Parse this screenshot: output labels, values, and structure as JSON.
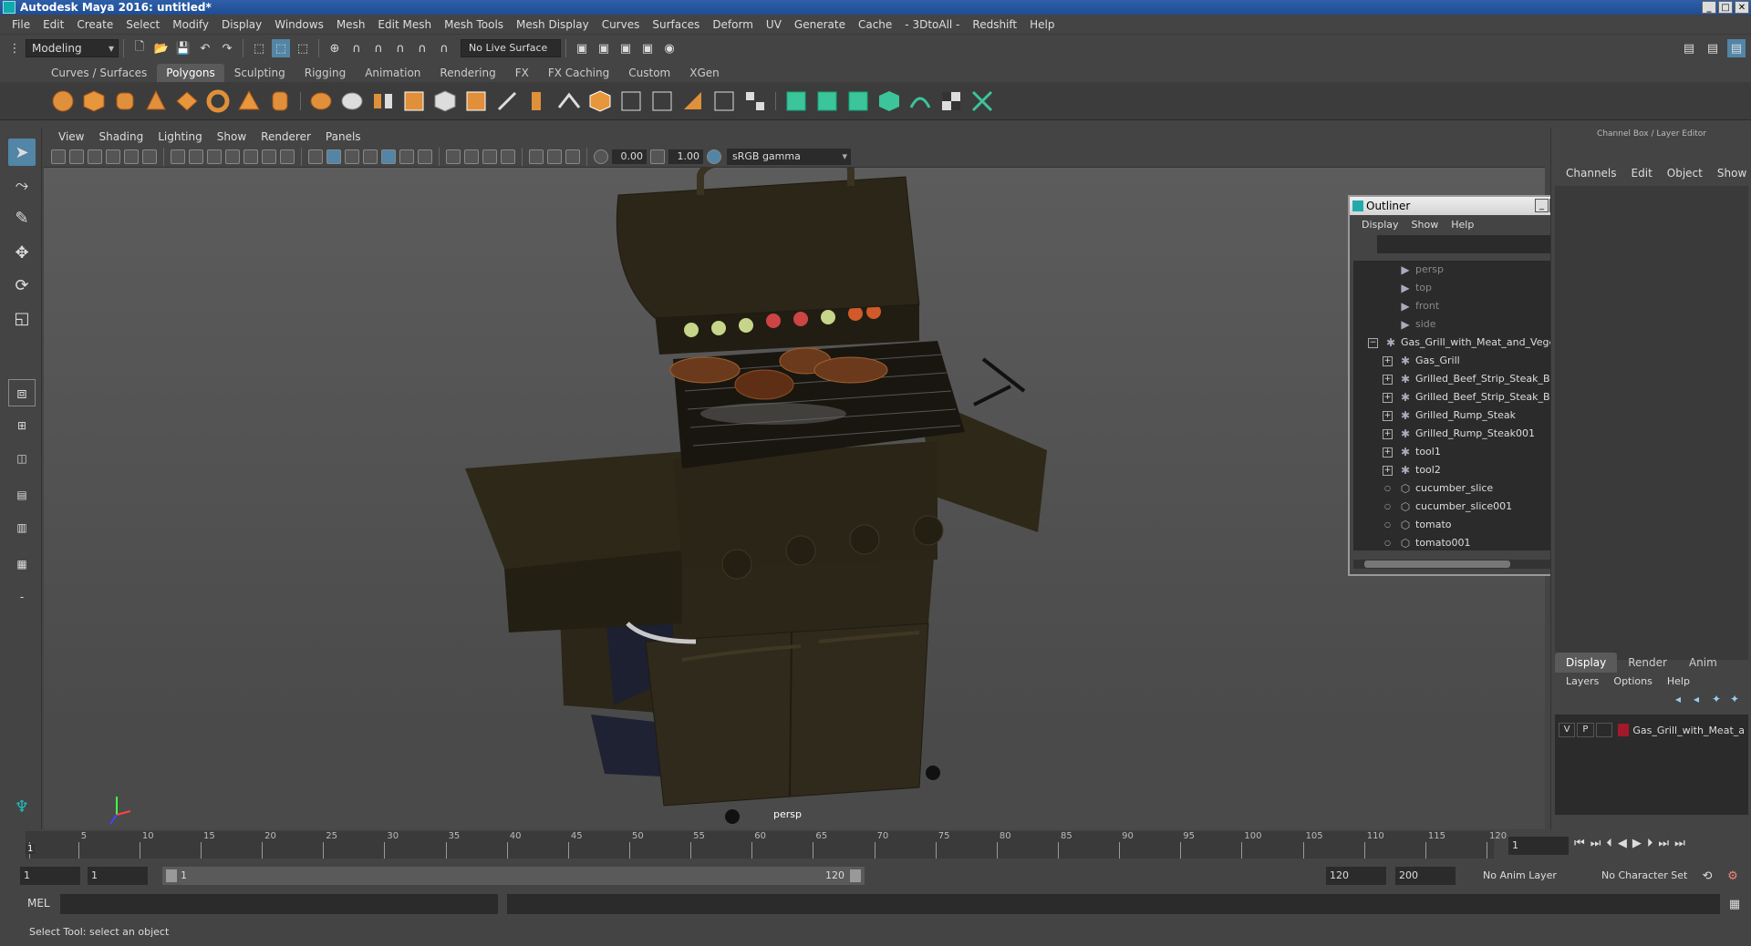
{
  "window": {
    "title": "Autodesk Maya 2016: untitled*",
    "min": "_",
    "max": "□",
    "close": "✕"
  },
  "menubar": [
    "File",
    "Edit",
    "Create",
    "Select",
    "Modify",
    "Display",
    "Windows",
    "Mesh",
    "Edit Mesh",
    "Mesh Tools",
    "Mesh Display",
    "Curves",
    "Surfaces",
    "Deform",
    "UV",
    "Generate",
    "Cache",
    "- 3DtoAll -",
    "Redshift",
    "Help"
  ],
  "statusline": {
    "mode": "Modeling",
    "live_surface": "No Live Surface"
  },
  "shelf": {
    "tabs": [
      "Curves / Surfaces",
      "Polygons",
      "Sculpting",
      "Rigging",
      "Animation",
      "Rendering",
      "FX",
      "FX Caching",
      "Custom",
      "XGen"
    ],
    "active_tab": "Polygons"
  },
  "panel": {
    "menus": [
      "View",
      "Shading",
      "Lighting",
      "Show",
      "Renderer",
      "Panels"
    ],
    "exposure": "0.00",
    "gamma_value": "1.00",
    "color_space": "sRGB gamma",
    "camera_label": "persp"
  },
  "outliner": {
    "title": "Outliner",
    "menus": [
      "Display",
      "Show",
      "Help"
    ],
    "items": [
      {
        "label": "persp",
        "type": "camera",
        "dim": true
      },
      {
        "label": "top",
        "type": "camera",
        "dim": true
      },
      {
        "label": "front",
        "type": "camera",
        "dim": true
      },
      {
        "label": "side",
        "type": "camera",
        "dim": true
      },
      {
        "label": "Gas_Grill_with_Meat_and_Vegeta",
        "type": "group",
        "expander": "−"
      },
      {
        "label": "Gas_Grill",
        "type": "group",
        "expander": "+"
      },
      {
        "label": "Grilled_Beef_Strip_Steak_Bon",
        "type": "group",
        "expander": "+"
      },
      {
        "label": "Grilled_Beef_Strip_Steak_Bon",
        "type": "group",
        "expander": "+"
      },
      {
        "label": "Grilled_Rump_Steak",
        "type": "group",
        "expander": "+"
      },
      {
        "label": "Grilled_Rump_Steak001",
        "type": "group",
        "expander": "+"
      },
      {
        "label": "tool1",
        "type": "group",
        "expander": "+"
      },
      {
        "label": "tool2",
        "type": "group",
        "expander": "+"
      },
      {
        "label": "cucumber_slice",
        "type": "mesh"
      },
      {
        "label": "cucumber_slice001",
        "type": "mesh"
      },
      {
        "label": "tomato",
        "type": "mesh"
      },
      {
        "label": "tomato001",
        "type": "mesh"
      }
    ]
  },
  "channelbox": {
    "title": "Channel Box / Layer Editor",
    "menus": [
      "Channels",
      "Edit",
      "Object",
      "Show"
    ]
  },
  "layer_editor": {
    "tabs": [
      "Display",
      "Render",
      "Anim"
    ],
    "active_tab": "Display",
    "menus": [
      "Layers",
      "Options",
      "Help"
    ],
    "layers": [
      {
        "v": "V",
        "p": "P",
        "color": "#a3182a",
        "name": "Gas_Grill_with_Meat_a"
      }
    ]
  },
  "timeline": {
    "ticks": [
      1,
      5,
      10,
      15,
      20,
      25,
      30,
      35,
      40,
      45,
      50,
      55,
      60,
      65,
      70,
      75,
      80,
      85,
      90,
      95,
      100,
      105,
      110,
      115,
      120
    ],
    "labeled": [
      5,
      10,
      15,
      20,
      25,
      30,
      35,
      40,
      45,
      50,
      55,
      60,
      65,
      70,
      75,
      80,
      85,
      90,
      95,
      100,
      105,
      110,
      115,
      120
    ],
    "current_frame_marker": "1",
    "current_frame": "1"
  },
  "range": {
    "start": "1",
    "playback_start": "1",
    "slider_start": "1",
    "slider_end": "120",
    "playback_end": "120",
    "end": "200",
    "anim_layer": "No Anim Layer",
    "character_set": "No Character Set"
  },
  "cmdline": {
    "label": "MEL"
  },
  "helpline": {
    "text": "Select Tool: select an object"
  }
}
